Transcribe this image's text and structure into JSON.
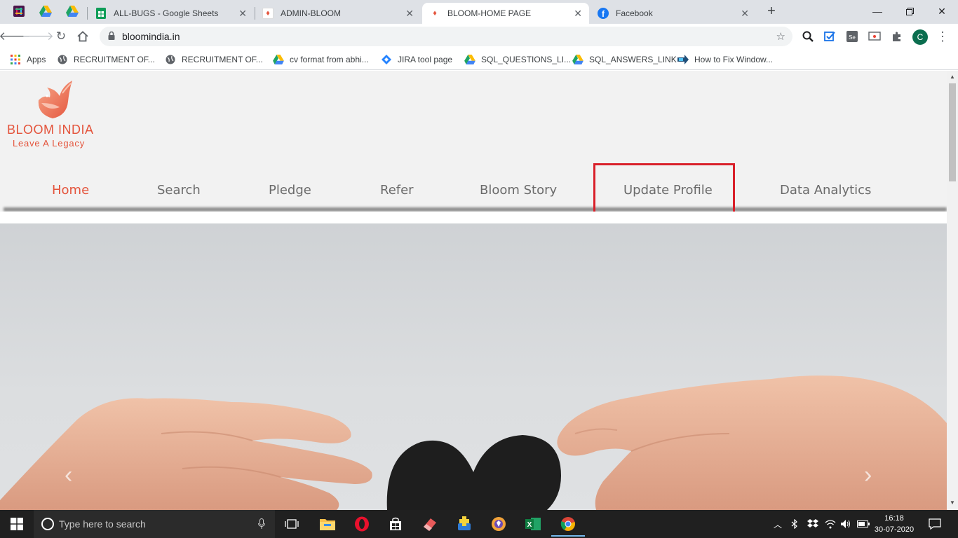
{
  "browser": {
    "tabs": [
      {
        "title": "ALL-BUGS - Google Sheets"
      },
      {
        "title": "ADMIN-BLOOM"
      },
      {
        "title": "BLOOM-HOME PAGE"
      },
      {
        "title": "Facebook"
      }
    ],
    "new_tab_label": "+",
    "url": "bloomindia.in",
    "profile_initial": "C",
    "bookmarks": [
      {
        "label": "Apps",
        "icon": "apps-grid-icon"
      },
      {
        "label": "RECRUITMENT OF...",
        "icon": "globe-icon"
      },
      {
        "label": "RECRUITMENT OF...",
        "icon": "globe-icon"
      },
      {
        "label": "cv format from abhi...",
        "icon": "google-drive-icon"
      },
      {
        "label": "JIRA tool page",
        "icon": "jira-icon"
      },
      {
        "label": "SQL_QUESTIONS_LI...",
        "icon": "google-drive-icon"
      },
      {
        "label": "SQL_ANSWERS_LINK",
        "icon": "google-drive-icon"
      },
      {
        "label": "How to Fix Window...",
        "icon": "link-icon"
      }
    ]
  },
  "site": {
    "logo": {
      "name": "BLOOM INDIA",
      "tagline": "Leave A Legacy"
    },
    "menu": [
      {
        "label": "Home",
        "active": true
      },
      {
        "label": "Search"
      },
      {
        "label": "Pledge"
      },
      {
        "label": "Refer"
      },
      {
        "label": "Bloom Story"
      },
      {
        "label": "Update Profile",
        "highlighted": true
      },
      {
        "label": "Data Analytics"
      }
    ],
    "accent_color": "#e4543c",
    "highlight_color": "#d9202a"
  },
  "taskbar": {
    "search_placeholder": "Type here to search",
    "time": "16:18",
    "date": "30-07-2020"
  }
}
